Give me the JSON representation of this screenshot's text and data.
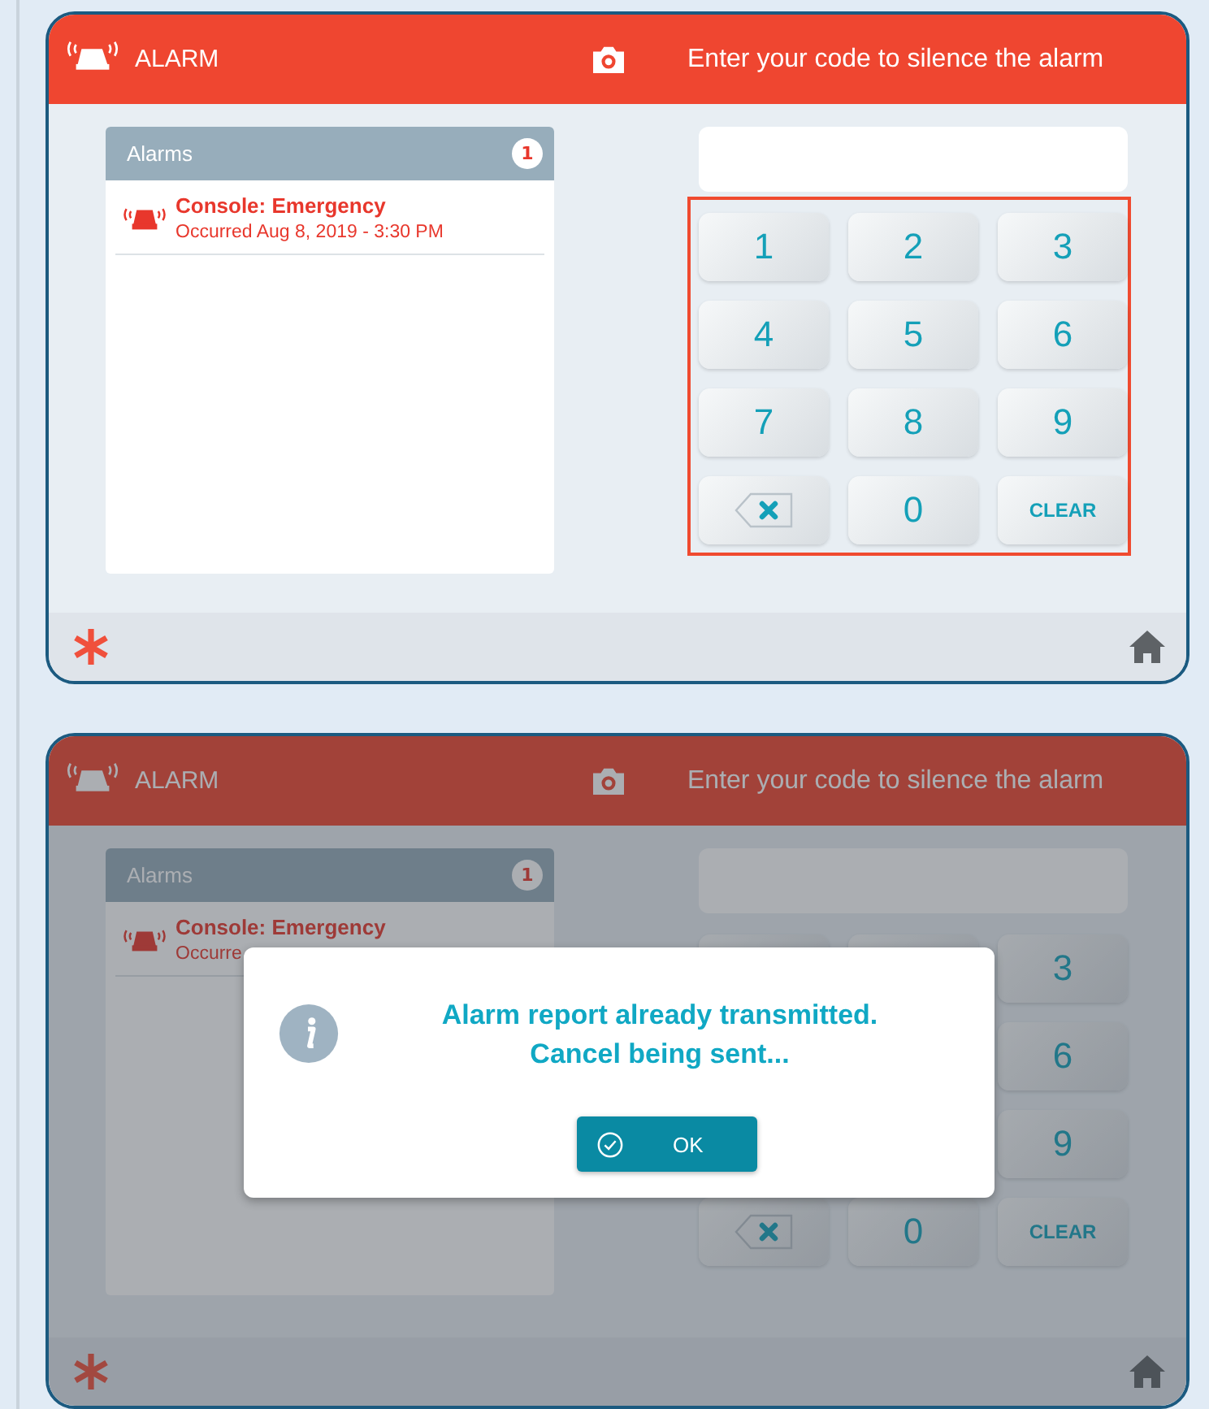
{
  "screens": [
    {
      "dimmed": false,
      "header": {
        "title": "ALARM",
        "prompt": "Enter your code to silence the alarm"
      },
      "alarms": {
        "title": "Alarms",
        "count": "1",
        "items": [
          {
            "name": "Console: Emergency",
            "time": "Occurred Aug 8, 2019 - 3:30 PM"
          }
        ]
      },
      "keypad": {
        "highlighted": true,
        "keys": [
          {
            "kind": "digit",
            "label": "1"
          },
          {
            "kind": "digit",
            "label": "2"
          },
          {
            "kind": "digit",
            "label": "3"
          },
          {
            "kind": "digit",
            "label": "4"
          },
          {
            "kind": "digit",
            "label": "5"
          },
          {
            "kind": "digit",
            "label": "6"
          },
          {
            "kind": "digit",
            "label": "7"
          },
          {
            "kind": "digit",
            "label": "8"
          },
          {
            "kind": "digit",
            "label": "9"
          },
          {
            "kind": "backspace"
          },
          {
            "kind": "digit",
            "label": "0"
          },
          {
            "kind": "clear",
            "label": "CLEAR"
          }
        ]
      }
    },
    {
      "dimmed": true,
      "header": {
        "title": "ALARM",
        "prompt": "Enter your code to silence the alarm"
      },
      "alarms": {
        "title": "Alarms",
        "count": "1",
        "items": [
          {
            "name": "Console: Emergency",
            "time": "Occurre"
          }
        ]
      },
      "keypad": {
        "highlighted": false,
        "keys": [
          {
            "kind": "blank"
          },
          {
            "kind": "blank"
          },
          {
            "kind": "digit",
            "label": "3"
          },
          {
            "kind": "blank"
          },
          {
            "kind": "blank"
          },
          {
            "kind": "digit",
            "label": "6"
          },
          {
            "kind": "blank"
          },
          {
            "kind": "blank"
          },
          {
            "kind": "digit",
            "label": "9"
          },
          {
            "kind": "backspace"
          },
          {
            "kind": "digit",
            "label": "0"
          },
          {
            "kind": "clear",
            "label": "CLEAR"
          }
        ]
      },
      "dialog": {
        "lines": [
          "Alarm report already transmitted.",
          "Cancel being sent..."
        ],
        "button": "OK"
      }
    }
  ]
}
